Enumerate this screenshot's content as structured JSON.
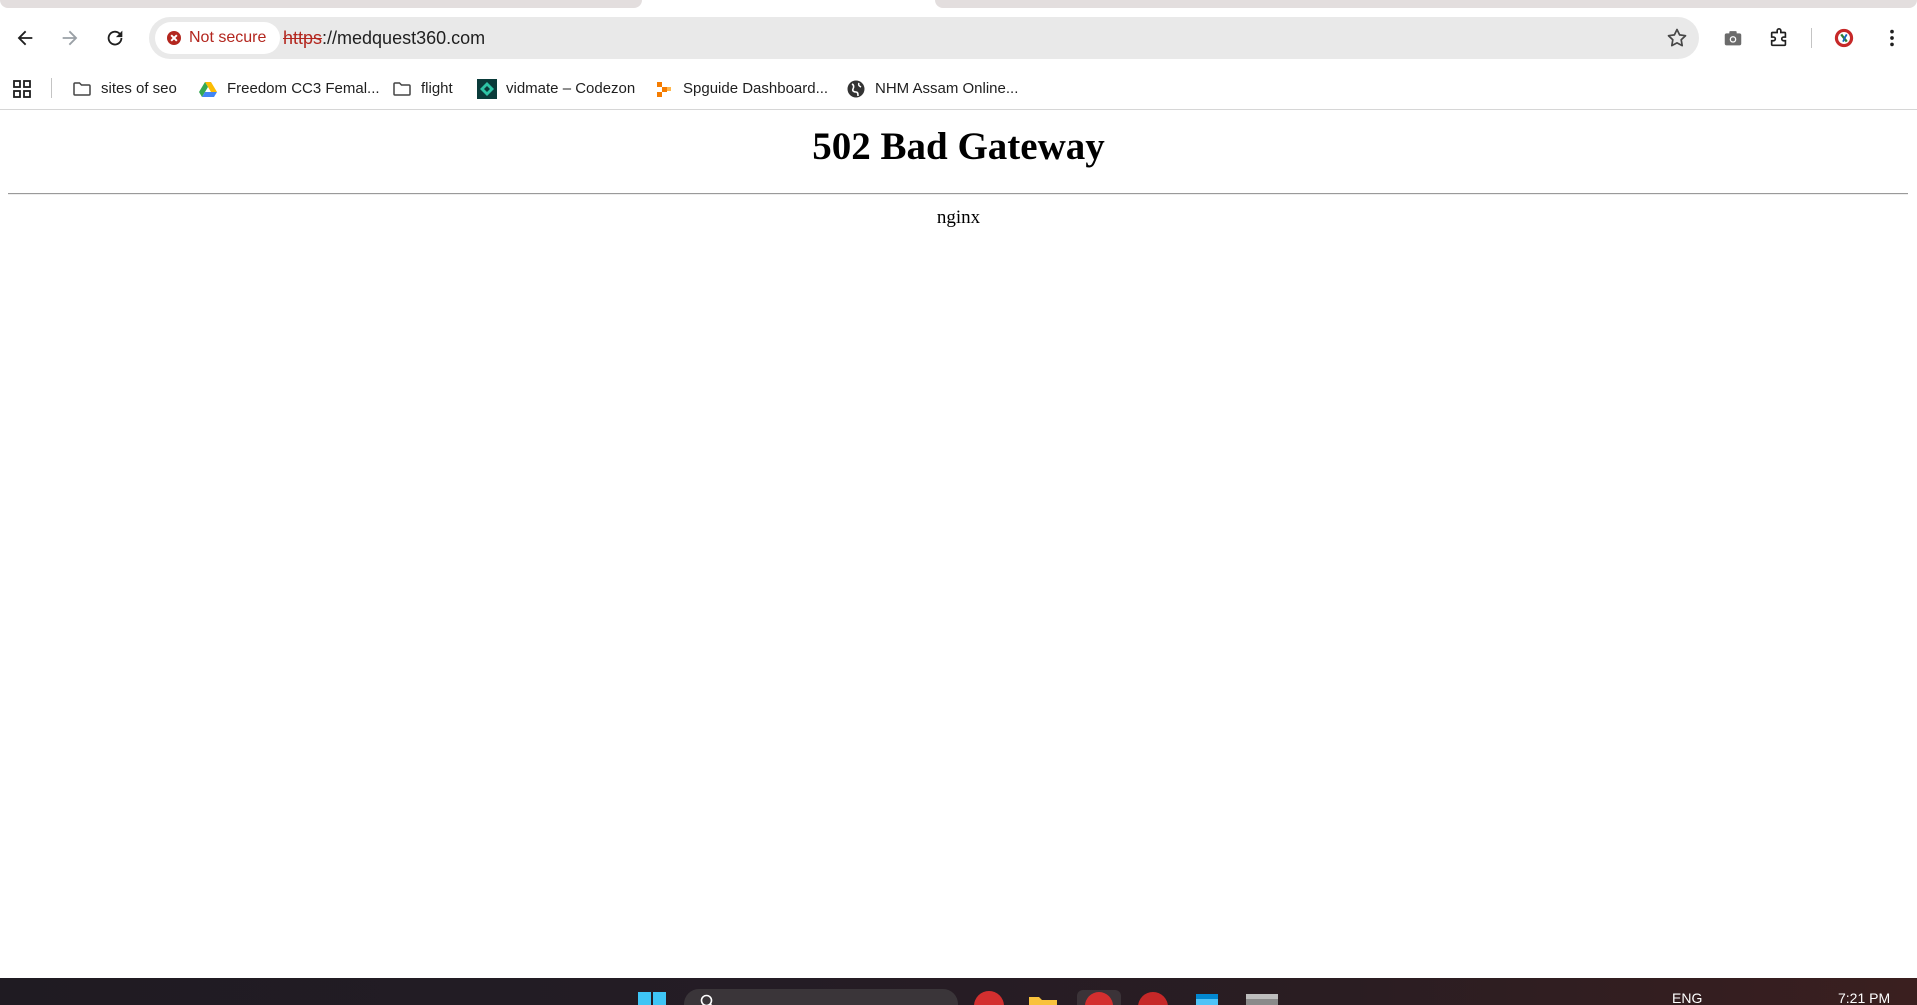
{
  "browser": {
    "nav": {
      "back_icon": "arrow-left-icon",
      "forward_icon": "arrow-right-icon",
      "reload_icon": "reload-icon"
    },
    "security_label": "Not secure",
    "url_scheme": "https",
    "url_rest": "://medquest360.com",
    "toolbar_icons": [
      "bookmark-star-icon",
      "camera-icon",
      "extensions-icon",
      "profile-avatar-icon",
      "menu-kebab-icon"
    ]
  },
  "bookmarks": [
    {
      "label": "sites of seo",
      "icon": "folder-icon"
    },
    {
      "label": "Freedom CC3 Femal...",
      "icon": "google-drive-icon"
    },
    {
      "label": "flight",
      "icon": "folder-icon"
    },
    {
      "label": "vidmate – Codezon",
      "icon": "codezon-icon"
    },
    {
      "label": "Spguide Dashboard...",
      "icon": "spguide-icon"
    },
    {
      "label": "NHM Assam Online...",
      "icon": "globe-icon"
    }
  ],
  "page": {
    "title": "502 Bad Gateway",
    "server": "nginx"
  },
  "taskbar": {
    "language": "ENG",
    "time": "7:21 PM"
  },
  "colors": {
    "warning_red": "#b3261e",
    "omnibox_bg": "#e9e9e9",
    "taskbar_bg": "#1f1b22"
  }
}
